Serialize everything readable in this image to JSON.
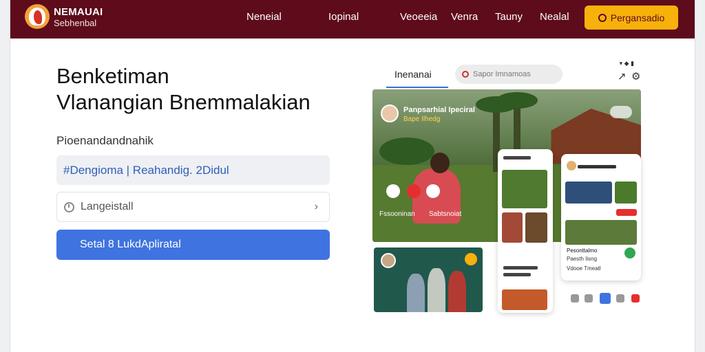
{
  "brand": {
    "title": "NEMAUAI",
    "subtitle": "Sebhenbal"
  },
  "nav": {
    "links": [
      "Neneial",
      "Iopinal",
      "Veoeeia",
      "Venra",
      "Tauny",
      "Nealal"
    ],
    "cta": "Pergansadio"
  },
  "hero": {
    "title_line1": "Benketiman",
    "title_line2": "Vlanangian Bnemmalakian",
    "subtitle": "Pioenandandnahik"
  },
  "form": {
    "field1_value": "#Dengioma | Reahandig. 2Didul",
    "field2_value": "Langeistall",
    "submit": "Setal 8 LukdApliratal"
  },
  "mockup": {
    "tab": "Inenanai",
    "search": "Sapor Imnamoas",
    "main_title": "Panpsarhial Ipeciral",
    "main_subtitle": "Bape Ilhedg",
    "label_left": "Fssooninan",
    "label_right": "Sabtsnoiat",
    "right_card_title": "Pesonttalmo",
    "right_card_line": "Paesth Iisng",
    "right_card_line2": "Vdooe Tmeatl"
  },
  "colors": {
    "nav_bg": "#5e0b1c",
    "cta": "#f7b10a",
    "submit": "#3f73e0",
    "link": "#2f5fb7"
  }
}
